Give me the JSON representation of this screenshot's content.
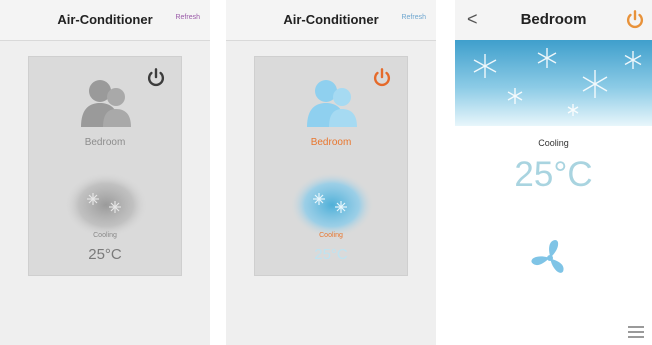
{
  "screens": [
    {
      "title": "Air-Conditioner",
      "refresh_label": "Refresh",
      "room_name": "Bedroom",
      "mode": "Cooling",
      "temperature": "25°C",
      "colors": {
        "accent": "#9a5aa8",
        "power": "#3c3c3c",
        "room_text": "#8c8c8c",
        "temp_text": "#7a7a7a",
        "icon": "#9a9a9a"
      },
      "icons": [
        "power-icon",
        "user-group-icon",
        "snowflake-icon"
      ]
    },
    {
      "title": "Air-Conditioner",
      "refresh_label": "Refresh",
      "room_name": "Bedroom",
      "mode": "Cooling",
      "temperature": "25°C",
      "colors": {
        "accent": "#6ea6cf",
        "power": "#e56a2a",
        "room_text": "#e8762e",
        "temp_text": "#bfe3f0",
        "icon": "#8fd0ef"
      },
      "icons": [
        "power-icon",
        "user-group-icon",
        "snowflake-icon"
      ]
    },
    {
      "title": "Bedroom",
      "back_label": "<",
      "mode": "Cooling",
      "temperature": "25°C",
      "colors": {
        "power": "#e8923a",
        "temp_text": "#a9d4e0",
        "fan": "#7fc4e6",
        "sky_top": "#3f9fcc",
        "sky_bottom": "#e8f6fb"
      },
      "icons": [
        "back-icon",
        "power-icon",
        "fan-icon",
        "menu-icon"
      ]
    }
  ]
}
